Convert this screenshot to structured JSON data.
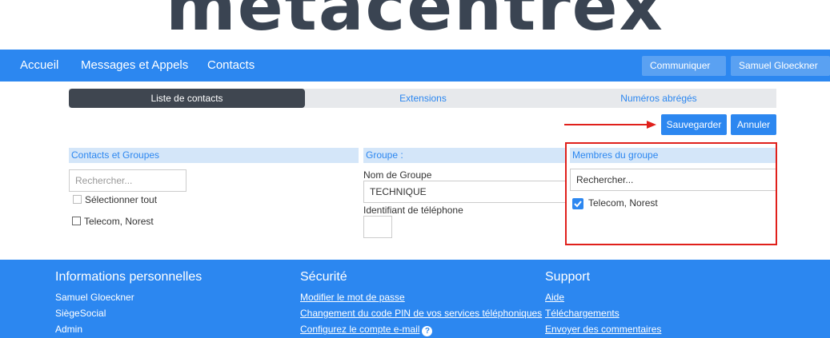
{
  "logo": {
    "text": "metacentrex"
  },
  "nav": {
    "home": "Accueil",
    "messages": "Messages et Appels",
    "contacts": "Contacts",
    "communicate": "Communiquer",
    "user": "Samuel Gloeckner"
  },
  "tabs": [
    {
      "label": "Liste de contacts",
      "active": true
    },
    {
      "label": "Extensions",
      "active": false
    },
    {
      "label": "Numéros abrégés",
      "active": false
    }
  ],
  "actions": {
    "save": "Sauvegarder",
    "cancel": "Annuler"
  },
  "contacts_panel": {
    "title": "Contacts et Groupes",
    "search_placeholder": "Rechercher...",
    "select_all": "Sélectionner tout",
    "items": [
      "Telecom, Norest"
    ]
  },
  "group_panel": {
    "title": "Groupe :",
    "name_label": "Nom de Groupe",
    "name_value": "TECHNIQUE",
    "phone_id_label": "Identifiant de téléphone",
    "phone_id_value": ""
  },
  "members_panel": {
    "title": "Membres du groupe",
    "search_placeholder": "Rechercher...",
    "members": [
      {
        "name": "Telecom, Norest",
        "checked": true
      }
    ]
  },
  "footer": {
    "personal": {
      "title": "Informations personnelles",
      "items": [
        "Samuel Gloeckner",
        "SiègeSocial",
        "Admin"
      ]
    },
    "security": {
      "title": "Sécurité",
      "links": [
        "Modifier le mot de passe",
        "Changement du code PIN de vos services téléphoniques",
        "Configurez le compte e-mail"
      ]
    },
    "support": {
      "title": "Support",
      "links": [
        "Aide",
        "Téléchargements",
        "Envoyer des commentaires"
      ]
    }
  },
  "colors": {
    "brand_blue": "#2c87f0",
    "annotation_red": "#e0201b",
    "active_tab": "#3f4650"
  }
}
